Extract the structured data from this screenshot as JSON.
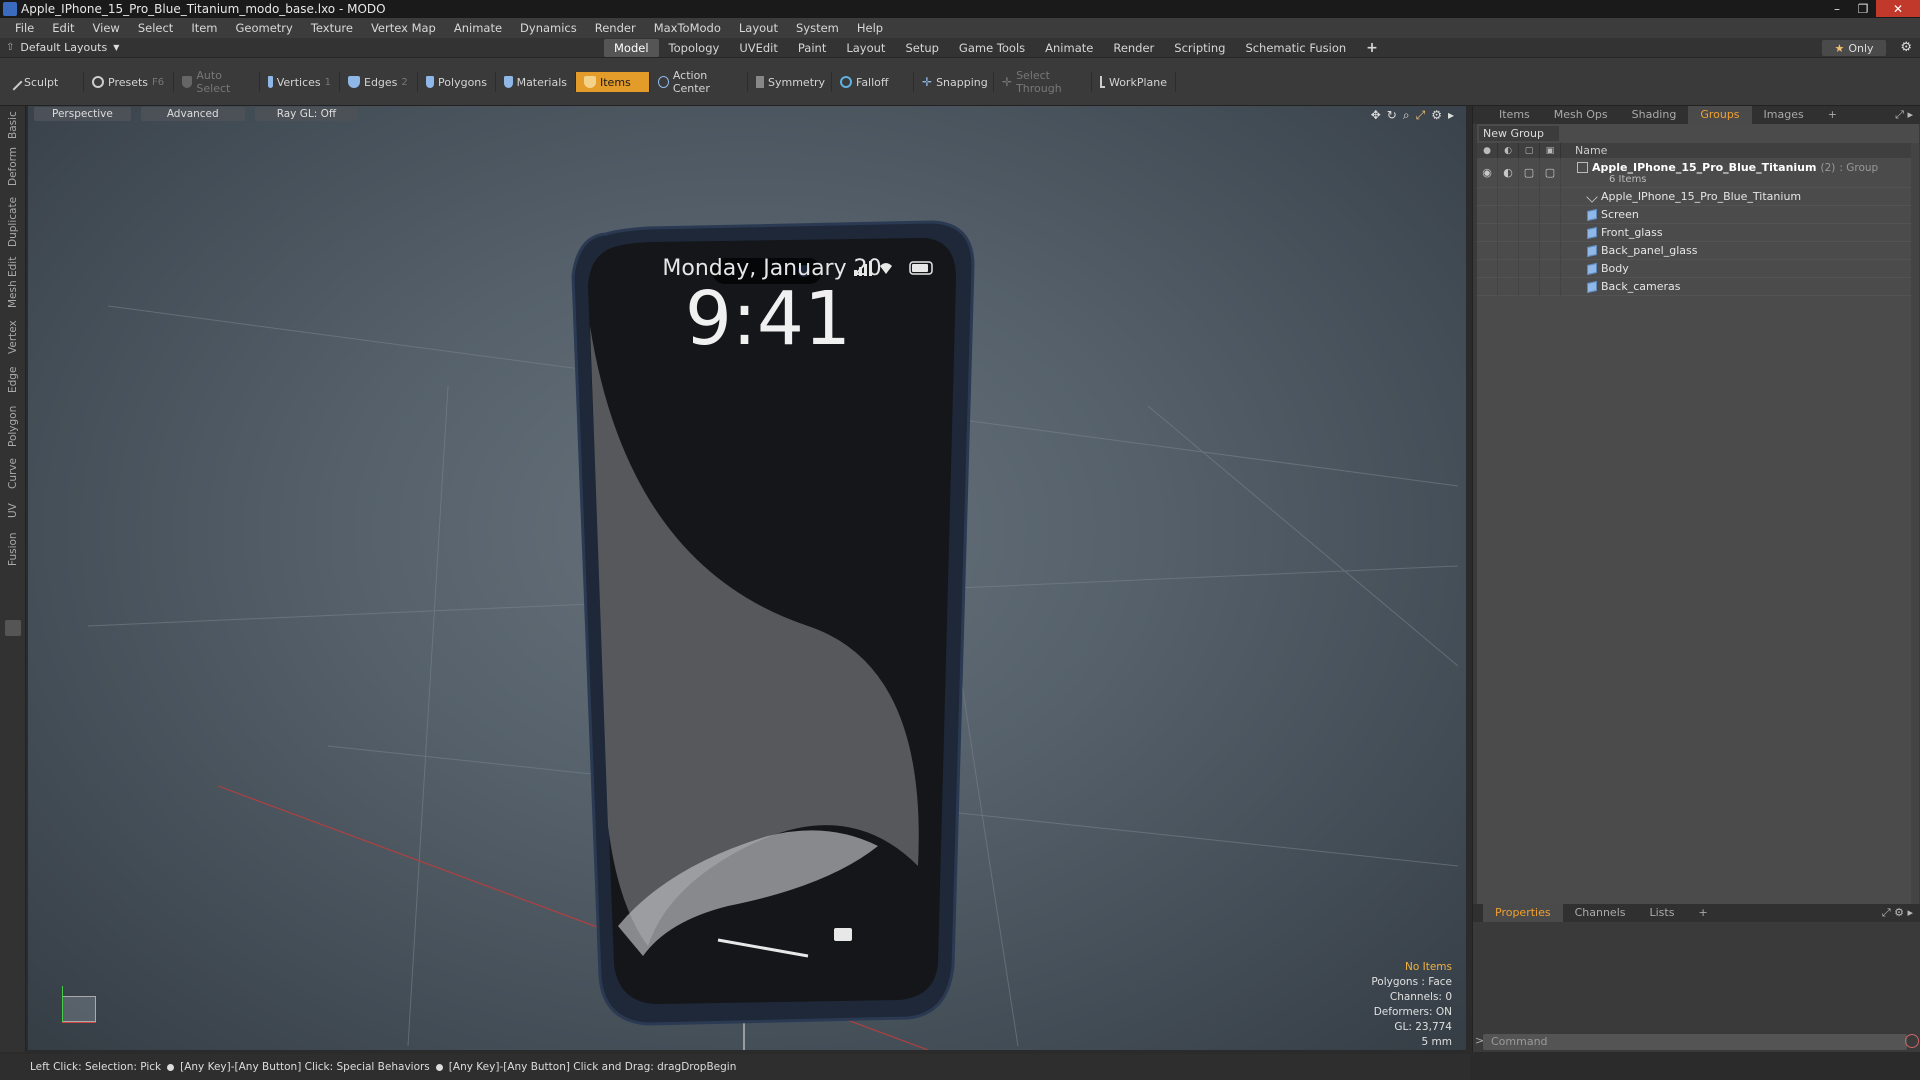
{
  "window": {
    "title": "Apple_IPhone_15_Pro_Blue_Titanium_modo_base.lxo - MODO",
    "controls": [
      "–",
      "❐",
      "✕"
    ]
  },
  "menu": [
    "File",
    "Edit",
    "View",
    "Select",
    "Item",
    "Geometry",
    "Texture",
    "Vertex Map",
    "Animate",
    "Dynamics",
    "Render",
    "MaxToModo",
    "Layout",
    "System",
    "Help"
  ],
  "layoutbar": {
    "layout_selector": "Default Layouts",
    "tabs": [
      "Model",
      "Topology",
      "UVEdit",
      "Paint",
      "Layout",
      "Setup",
      "Game Tools",
      "Animate",
      "Render",
      "Scripting",
      "Schematic Fusion"
    ],
    "active_tab": "Model",
    "add_label": "+",
    "only_label": "Only"
  },
  "toolbar": {
    "sculpt": "Sculpt",
    "presets": "Presets",
    "presets_key": "F6",
    "auto_select": "Auto Select",
    "vertices": "Vertices",
    "vertices_key": "1",
    "edges": "Edges",
    "edges_key": "2",
    "polygons": "Polygons",
    "materials": "Materials",
    "items": "Items",
    "action_center": "Action Center",
    "symmetry": "Symmetry",
    "falloff": "Falloff",
    "snapping": "Snapping",
    "select_through": "Select Through",
    "workplane": "WorkPlane"
  },
  "left_tabs": [
    "Basic",
    "Deform",
    "Duplicate",
    "Mesh Edit",
    "Vertex",
    "Edge",
    "Polygon",
    "Curve",
    "UV",
    "Fusion"
  ],
  "viewport": {
    "view": "Perspective",
    "shading": "Advanced",
    "raygl": "Ray GL: Off",
    "phone_screen": {
      "date": "Monday, January 20",
      "time": "9:41"
    },
    "stats": {
      "selection": "No Items",
      "polygons": "Polygons : Face",
      "channels": "Channels: 0",
      "deformers": "Deformers: ON",
      "gl": "GL: 23,774",
      "scale": "5 mm"
    }
  },
  "right_panel": {
    "tabs": [
      "Items",
      "Mesh Ops",
      "Shading",
      "Groups",
      "Images"
    ],
    "active_tab": "Groups",
    "new_group": "New Group",
    "column_name": "Name",
    "group": {
      "name": "Apple_IPhone_15_Pro_Blue_Titanium",
      "count": "(2)",
      "type": ": Group",
      "subtitle": "6 Items"
    },
    "items": [
      "Apple_IPhone_15_Pro_Blue_Titanium",
      "Screen",
      "Front_glass",
      "Back_panel_glass",
      "Body",
      "Back_cameras"
    ]
  },
  "properties": {
    "tabs": [
      "Properties",
      "Channels",
      "Lists"
    ],
    "active_tab": "Properties",
    "command_placeholder": "Command"
  },
  "statusbar": {
    "part1": "Left Click: Selection: Pick",
    "part2": "[Any Key]-[Any Button] Click: Special Behaviors",
    "part3": "[Any Key]-[Any Button] Click and Drag: dragDropBegin"
  },
  "colors": {
    "accent": "#e39b2a",
    "viewport_bg": "#55606a",
    "phone_body": "#1f2a3a",
    "screen": "#121418"
  }
}
